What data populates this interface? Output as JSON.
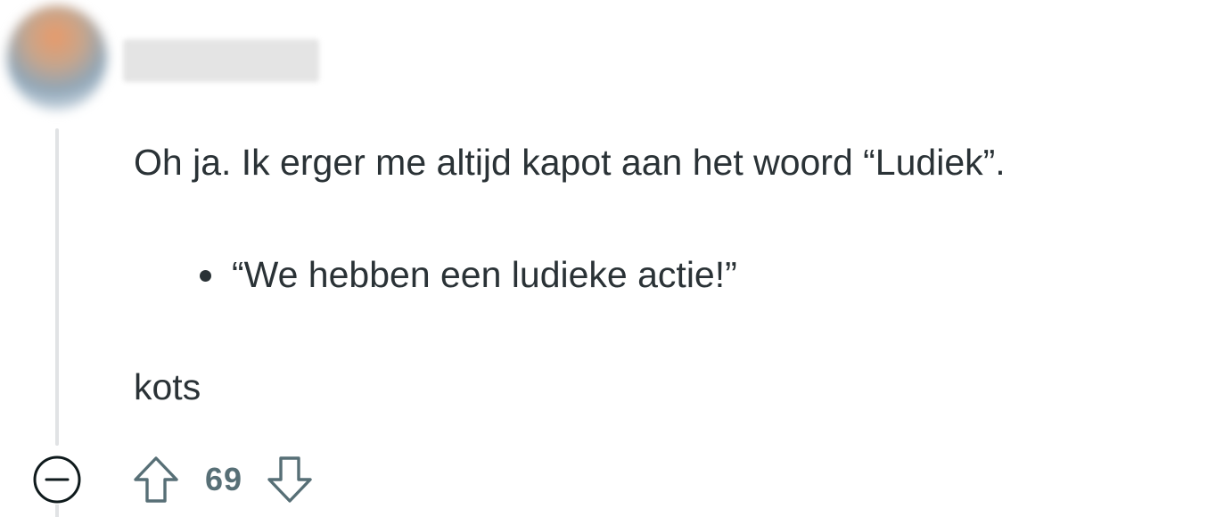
{
  "comment": {
    "author": "",
    "paragraphs": [
      "Oh ja. Ik erger me altijd kapot aan het woord “Ludiek”.",
      "kots"
    ],
    "list_items": [
      "“We hebben een ludieke actie!”"
    ],
    "score": "69"
  },
  "icons": {
    "collapse": "collapse-minus-icon",
    "upvote": "upvote-arrow-icon",
    "downvote": "downvote-arrow-icon"
  },
  "colors": {
    "text": "#2a3236",
    "muted": "#576f76",
    "thread_line": "#e1e3e5"
  }
}
